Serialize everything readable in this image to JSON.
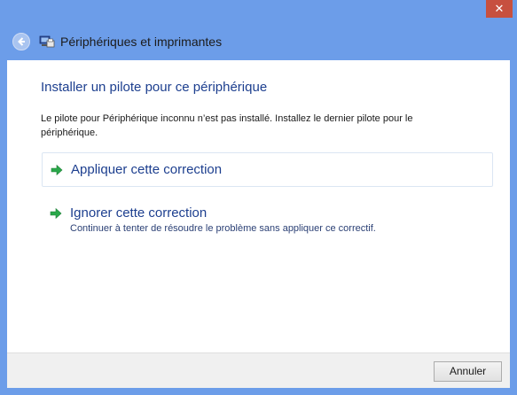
{
  "window": {
    "title": "Périphériques et imprimantes",
    "close_glyph": "✕"
  },
  "content": {
    "heading": "Installer un pilote pour ce périphérique",
    "description": "Le pilote pour Périphérique inconnu n’est pas installé. Installez le dernier pilote pour le périphérique."
  },
  "options": [
    {
      "title": "Appliquer cette correction",
      "icon": "green-arrow-icon"
    },
    {
      "title": "Ignorer cette correction",
      "subtitle": "Continuer à tenter de résoudre le problème sans appliquer ce correctif.",
      "icon": "green-arrow-icon"
    }
  ],
  "footer": {
    "cancel_label": "Annuler"
  },
  "colors": {
    "frame": "#6c9de9",
    "close": "#c7503f",
    "link_blue": "#1d3f8f",
    "arrow_green": "#2aa84a"
  }
}
